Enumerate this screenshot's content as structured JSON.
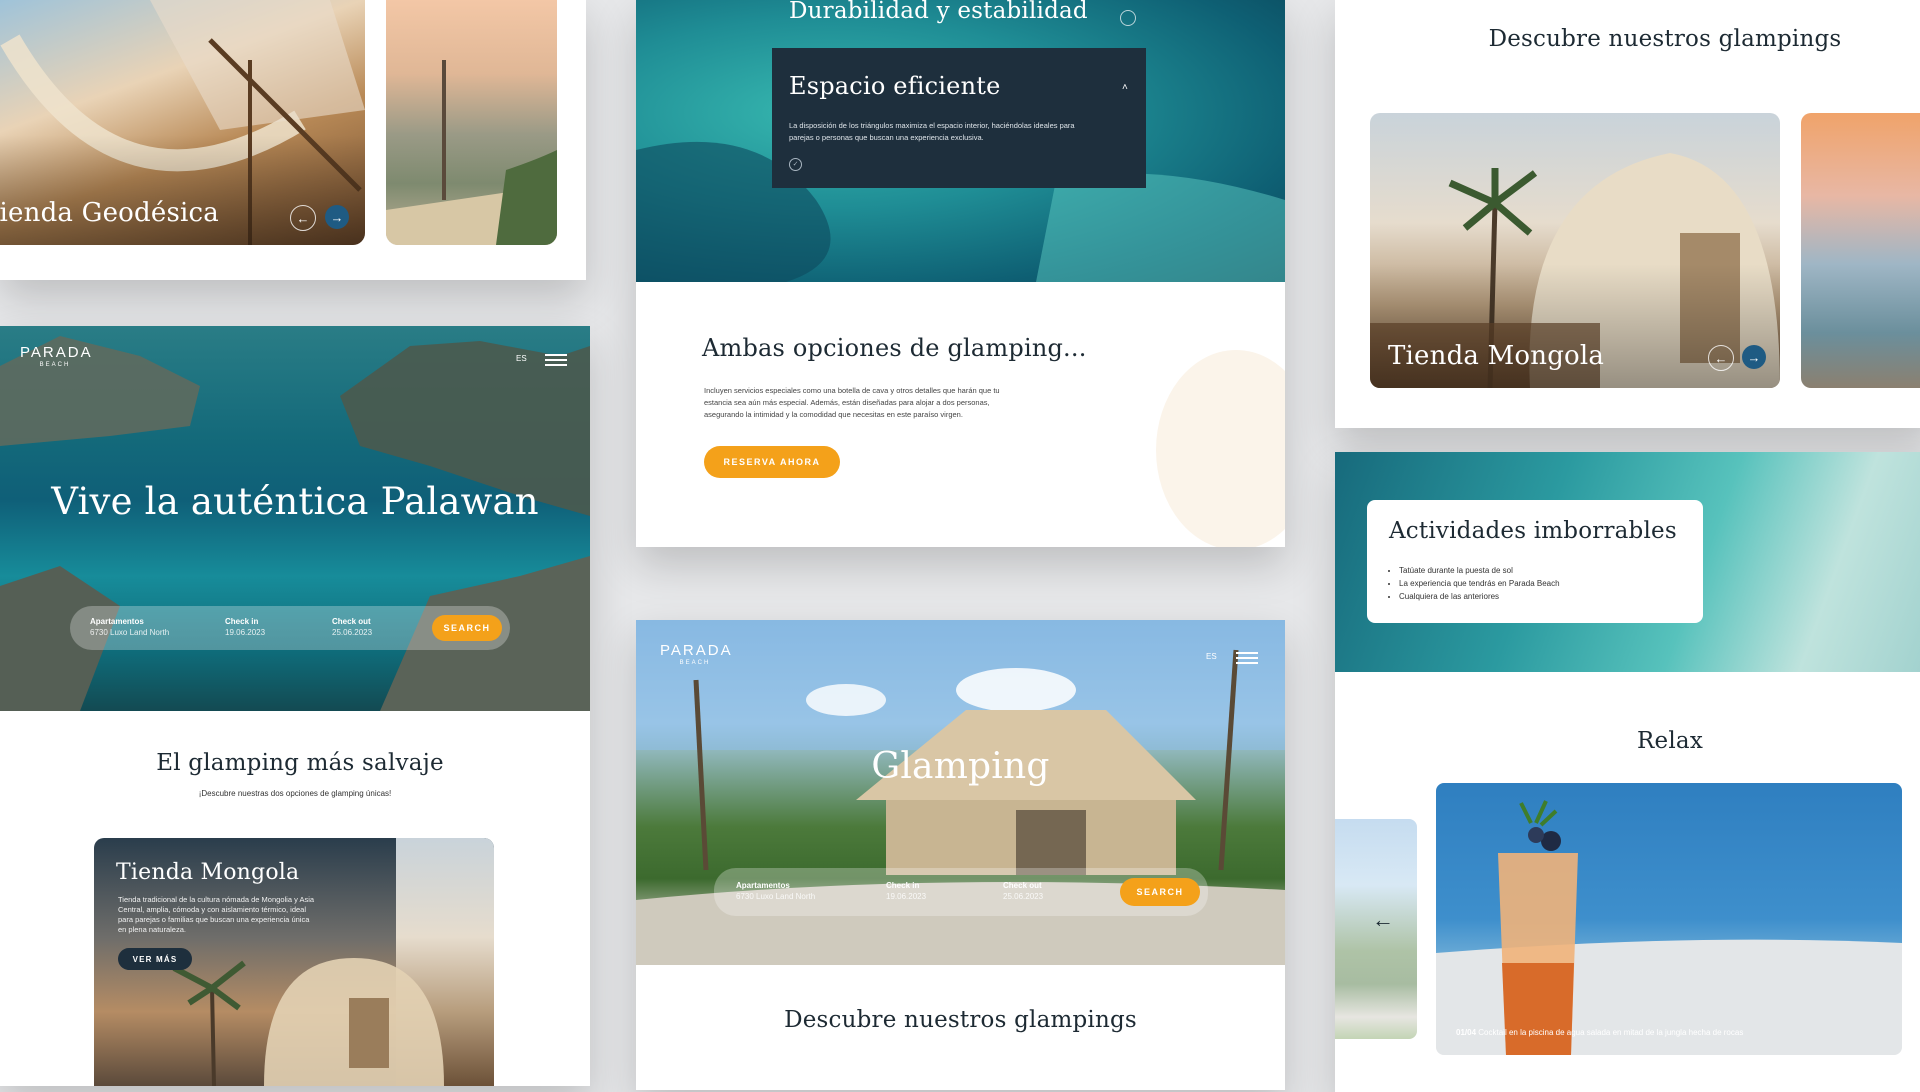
{
  "card_geodesica": {
    "slide_title": "Tienda Geodésica"
  },
  "card_palawan": {
    "logo_main": "PARADA",
    "logo_sub": "BEACH",
    "lang": "ES",
    "hero_title": "Vive la auténtica Palawan",
    "search": {
      "f1_label": "Apartamentos",
      "f1_value": "6730 Luxo Land North",
      "f2_label": "Check in",
      "f2_value": "19.06.2023",
      "f3_label": "Check out",
      "f3_value": "25.06.2023",
      "button": "SEARCH"
    },
    "section_title": "El glamping más salvaje",
    "section_sub": "¡Descubre nuestras dos opciones de glamping únicas!",
    "feature_title": "Tienda Mongola",
    "feature_text": "Tienda tradicional de la cultura nómada de Mongolia y Asia Central, amplia, cómoda y con aislamiento térmico, ideal para parejas o familias que buscan una experiencia única en plena naturaleza.",
    "feature_button": "VER MÁS"
  },
  "card_espacio": {
    "top_title": "Durabilidad y estabilidad",
    "panel_title": "Espacio eficiente",
    "panel_text": "La disposición de los triángulos maximiza el espacio interior, haciéndolas ideales para parejas o personas que buscan una experiencia exclusiva.",
    "heading": "Ambas opciones de glamping...",
    "body": "Incluyen servicios especiales como una botella de cava y otros detalles que harán que tu estancia sea aún más especial. Además, están diseñadas para alojar a dos personas, asegurando la intimidad y la comodidad que necesitas en este paraíso virgen.",
    "button": "RESERVA AHORA"
  },
  "card_glamping": {
    "logo_main": "PARADA",
    "logo_sub": "BEACH",
    "lang": "ES",
    "hero_title": "Glamping",
    "search": {
      "f1_label": "Apartamentos",
      "f1_value": "6730 Luxo Land North",
      "f2_label": "Check in",
      "f2_value": "19.06.2023",
      "f3_label": "Check out",
      "f3_value": "25.06.2023",
      "button": "SEARCH"
    },
    "section_title": "Descubre nuestros glampings"
  },
  "card_descubre": {
    "title": "Descubre nuestros glampings",
    "slide_title": "Tienda Mongola"
  },
  "card_actividades": {
    "title": "Actividades imborrables",
    "items": [
      "Tatúate durante la puesta de sol",
      "La experiencia que tendrás en Parada Beach",
      "Cualquiera de las anteriores"
    ],
    "relax_title": "Relax",
    "caption_index": "01/04",
    "caption_text": "Cocktail en la piscina de agua salada en mitad de la jungla hecha de rocas"
  },
  "colors": {
    "accent_orange": "#f4a11a",
    "navy": "#1e2f3d",
    "arrow_blue": "#1f5b83"
  }
}
